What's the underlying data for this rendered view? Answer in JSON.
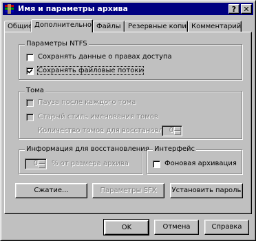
{
  "window": {
    "title": "Имя и параметры архива",
    "help_label": "?",
    "close_label": "✕"
  },
  "tabs": [
    {
      "label": "Общие"
    },
    {
      "label": "Дополнительно"
    },
    {
      "label": "Файлы"
    },
    {
      "label": "Резервные копии"
    },
    {
      "label": "Комментарий"
    }
  ],
  "ntfs": {
    "legend": "Параметры NTFS",
    "save_rights_label": "Сохранять данные о правах доступа",
    "save_rights_checked": false,
    "save_streams_label": "Сохранять файловые потоки",
    "save_streams_checked": true
  },
  "volumes": {
    "legend": "Тома",
    "pause_label": "Пауза после каждого тома",
    "old_naming_label": "Старый стиль именования томов",
    "recovery_count_label": "Количество томов для восстановления",
    "recovery_count_value": "0"
  },
  "recovery": {
    "legend": "Информация для восстановления",
    "percent_value": "0",
    "percent_label": "% от размера архива"
  },
  "interface": {
    "legend": "Интерфейс",
    "background_label": "Фоновая архивация",
    "background_checked": false
  },
  "buttons": {
    "compression": "Сжатие...",
    "sfx": "Параметры SFX",
    "password": "Установить пароль",
    "ok": "OK",
    "cancel": "Отмена",
    "help": "Справка"
  }
}
